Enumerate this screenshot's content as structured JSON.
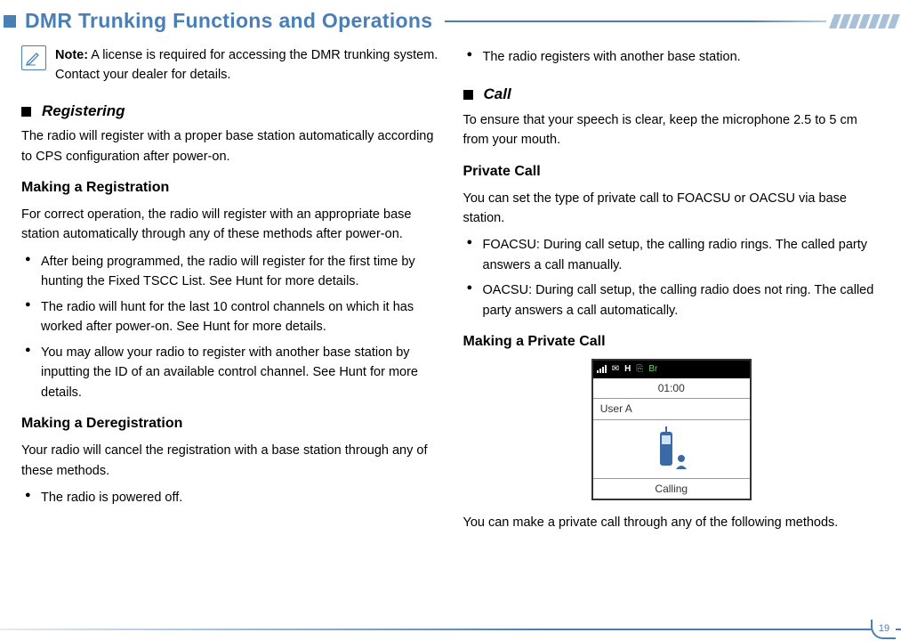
{
  "header": {
    "title": "DMR Trunking Functions and Operations"
  },
  "note": {
    "label": "Note:",
    "text": " A license is required for accessing the DMR trunking system. Contact your dealer for details."
  },
  "left": {
    "registering_title": "Registering",
    "registering_intro": "The radio will register with a proper base station automatically according to CPS configuration after power-on.",
    "making_reg_head": "Making a Registration",
    "making_reg_intro": "For correct operation, the radio will register with an appropriate base station automatically through any of these methods after power-on.",
    "reg_bullets": [
      "After being programmed, the radio will register for the first time by hunting the Fixed TSCC List. See Hunt for more details.",
      "The radio will hunt for the last 10 control channels on which it has worked after power-on. See Hunt for more details.",
      "You may allow your radio to register with another base station by inputting the ID of  an  available  control channel. See Hunt for more details."
    ],
    "making_dereg_head": "Making a Deregistration",
    "making_dereg_intro": "Your radio will cancel the registration with a base station through any of these methods.",
    "dereg_bullets": [
      "The radio is powered off."
    ]
  },
  "right": {
    "top_bullets": [
      "The radio registers with another base station."
    ],
    "call_title": "Call",
    "call_intro": "To ensure that your speech is clear, keep the microphone 2.5 to 5 cm from your mouth.",
    "private_call_head": "Private Call",
    "private_call_intro": "You can set the type of private call to FOACSU or OACSU via base station.",
    "pc_bullets": [
      "FOACSU: During call setup, the calling radio rings. The called party answers a call manually.",
      "OACSU: During call setup, the calling radio does not ring. The called party answers a call automatically."
    ],
    "making_pc_head": "Making a Private Call",
    "phone": {
      "status_h": "H",
      "status_br": "Br",
      "time": "01:00",
      "user": "User A",
      "calling": "Calling"
    },
    "pc_outro": "You can make a private call through any of the following methods."
  },
  "page_number": "19"
}
